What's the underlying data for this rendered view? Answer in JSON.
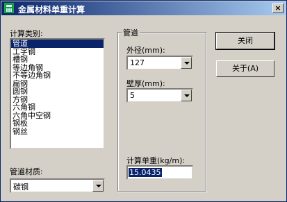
{
  "window": {
    "title": "金属材料单重计算",
    "close_glyph": "×"
  },
  "category": {
    "label": "计算类别:",
    "items": [
      "管道",
      "工字钢",
      "槽钢",
      "等边角钢",
      "不等边角钢",
      "扁钢",
      "圆钢",
      "方钢",
      "六角钢",
      "六角中空钢",
      "钢板",
      "钢丝"
    ],
    "selected_index": 0
  },
  "material": {
    "label": "管道材质:",
    "value": "碳钢"
  },
  "pipe_group": {
    "label": "管道",
    "outer_diameter": {
      "label": "外径(mm):",
      "value": "127"
    },
    "thickness": {
      "label": "壁厚(mm):",
      "value": "5"
    },
    "unit_weight": {
      "label": "计算单重(kg/m):",
      "value": "15.0435"
    }
  },
  "buttons": {
    "close": "关闭",
    "about": "关于(A)"
  },
  "colors": {
    "title_start": "#0a246a",
    "title_end": "#a6caf0",
    "selection": "#0a246a"
  }
}
